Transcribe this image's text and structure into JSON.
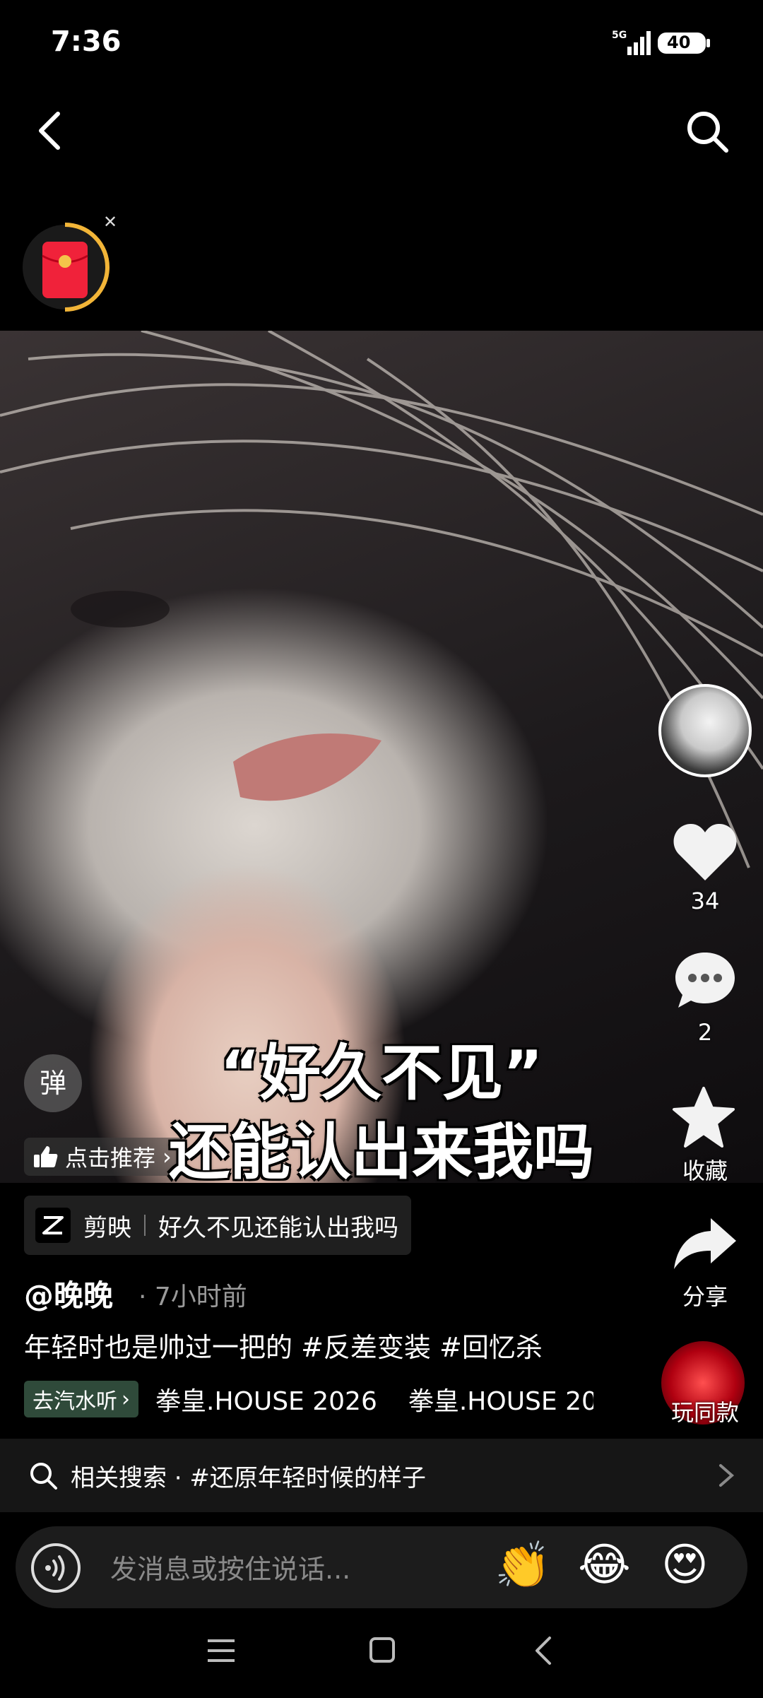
{
  "status": {
    "time": "7:36",
    "network": "5G",
    "battery": "40"
  },
  "video": {
    "caption_line1": "“好久不见”",
    "caption_line2": "还能认出来我吗",
    "danmu_label": "弹",
    "recommend_label": "点击推荐",
    "recommend_arrow": "›"
  },
  "rail": {
    "likes": "34",
    "comments": "2",
    "favorite_label": "收藏",
    "share_label": "分享",
    "game_label": "玩同款"
  },
  "info": {
    "capcut_app": "剪映",
    "capcut_template": "好久不见还能认出我吗",
    "author": "@晚晚",
    "time_ago": "· 7小时前",
    "description": "年轻时也是帅过一把的 #反差变装 #回忆杀",
    "qishui_label": "去汽水听",
    "music_title": "拳皇.HOUSE 2026",
    "music_title_repeat": "拳皇.HOUSE 20"
  },
  "related": {
    "label": "相关搜索 · #还原年轻时候的样子"
  },
  "message": {
    "placeholder": "发消息或按住说话...",
    "emoji1": "👏",
    "emoji2": "😂",
    "emoji3": "😍"
  },
  "icons": [
    "back-icon",
    "search-icon",
    "red-packet-icon",
    "like-icon",
    "comment-icon",
    "star-icon",
    "share-icon",
    "voice-icon"
  ]
}
